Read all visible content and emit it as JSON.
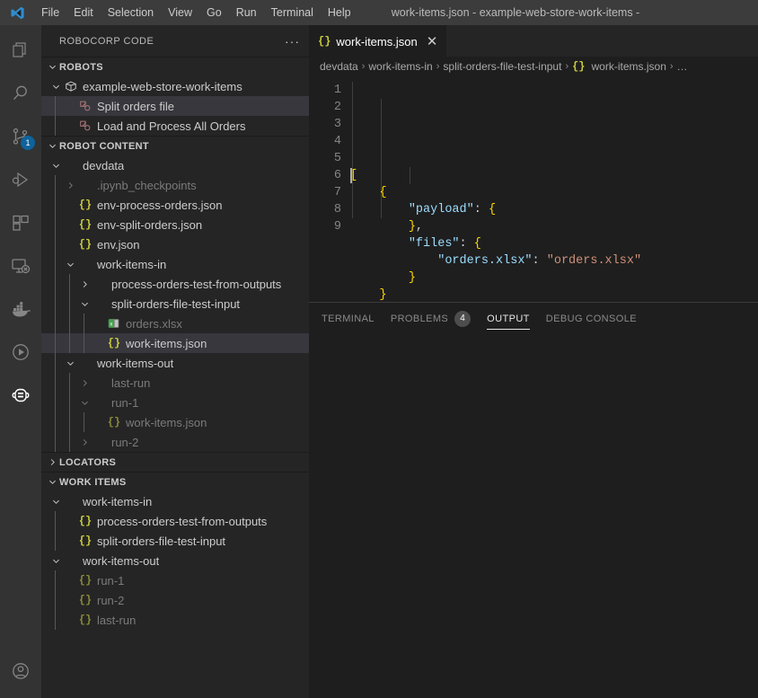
{
  "titlebar": {
    "window_title": "work-items.json - example-web-store-work-items -",
    "menu": [
      "File",
      "Edit",
      "Selection",
      "View",
      "Go",
      "Run",
      "Terminal",
      "Help"
    ]
  },
  "activitybar": {
    "items": [
      {
        "name": "explorer-icon",
        "active": false
      },
      {
        "name": "search-icon",
        "active": false
      },
      {
        "name": "source-control-icon",
        "active": false,
        "badge": "1"
      },
      {
        "name": "run-and-debug-icon",
        "active": false
      },
      {
        "name": "extensions-icon",
        "active": false
      },
      {
        "name": "remote-explorer-icon",
        "active": false
      },
      {
        "name": "docker-icon",
        "active": false
      },
      {
        "name": "test-play-icon",
        "active": false
      },
      {
        "name": "robocorp-robot-icon",
        "active": true
      }
    ],
    "bottom": [
      {
        "name": "account-icon",
        "active": false
      }
    ]
  },
  "sidebar": {
    "title": "ROBOCORP CODE",
    "more_actions": "···",
    "sections": [
      {
        "name": "robots",
        "label": "ROBOTS",
        "expanded": true,
        "rows": [
          {
            "label": "example-web-store-work-items",
            "indent": 1,
            "twisty": "down",
            "icon": "package-icon",
            "dim": false,
            "selected": false
          },
          {
            "label": "Split orders file",
            "indent": 2,
            "twisty": "none",
            "icon": "task-icon",
            "dim": false,
            "selected": true
          },
          {
            "label": "Load and Process All Orders",
            "indent": 2,
            "twisty": "none",
            "icon": "task-icon",
            "dim": false,
            "selected": false
          }
        ]
      },
      {
        "name": "robot-content",
        "label": "ROBOT CONTENT",
        "expanded": true,
        "rows": [
          {
            "label": "devdata",
            "indent": 1,
            "twisty": "down",
            "icon": "none",
            "dim": false,
            "selected": false
          },
          {
            "label": ".ipynb_checkpoints",
            "indent": 2,
            "twisty": "right",
            "icon": "none",
            "dim": true,
            "selected": false
          },
          {
            "label": "env-process-orders.json",
            "indent": 2,
            "twisty": "none",
            "icon": "json-icon",
            "dim": false,
            "selected": false
          },
          {
            "label": "env-split-orders.json",
            "indent": 2,
            "twisty": "none",
            "icon": "json-icon",
            "dim": false,
            "selected": false
          },
          {
            "label": "env.json",
            "indent": 2,
            "twisty": "none",
            "icon": "json-icon",
            "dim": false,
            "selected": false
          },
          {
            "label": "work-items-in",
            "indent": 2,
            "twisty": "down",
            "icon": "none",
            "dim": false,
            "selected": false
          },
          {
            "label": "process-orders-test-from-outputs",
            "indent": 3,
            "twisty": "right",
            "icon": "none",
            "dim": false,
            "selected": false
          },
          {
            "label": "split-orders-file-test-input",
            "indent": 3,
            "twisty": "down",
            "icon": "none",
            "dim": false,
            "selected": false
          },
          {
            "label": "orders.xlsx",
            "indent": 4,
            "twisty": "none",
            "icon": "xlsx-icon",
            "dim": true,
            "selected": false
          },
          {
            "label": "work-items.json",
            "indent": 4,
            "twisty": "none",
            "icon": "json-icon",
            "dim": false,
            "selected": true
          },
          {
            "label": "work-items-out",
            "indent": 2,
            "twisty": "down",
            "icon": "none",
            "dim": false,
            "selected": false
          },
          {
            "label": "last-run",
            "indent": 3,
            "twisty": "right",
            "icon": "none",
            "dim": true,
            "selected": false
          },
          {
            "label": "run-1",
            "indent": 3,
            "twisty": "down",
            "icon": "none",
            "dim": true,
            "selected": false
          },
          {
            "label": "work-items.json",
            "indent": 4,
            "twisty": "none",
            "icon": "json-icon",
            "dim": true,
            "selected": false
          },
          {
            "label": "run-2",
            "indent": 3,
            "twisty": "right",
            "icon": "none",
            "dim": true,
            "selected": false
          }
        ]
      },
      {
        "name": "locators",
        "label": "LOCATORS",
        "expanded": false,
        "rows": []
      },
      {
        "name": "work-items",
        "label": "WORK ITEMS",
        "expanded": true,
        "rows": [
          {
            "label": "work-items-in",
            "indent": 1,
            "twisty": "down",
            "icon": "none",
            "dim": false,
            "selected": false
          },
          {
            "label": "process-orders-test-from-outputs",
            "indent": 2,
            "twisty": "none",
            "icon": "json-icon",
            "dim": false,
            "selected": false
          },
          {
            "label": "split-orders-file-test-input",
            "indent": 2,
            "twisty": "none",
            "icon": "json-icon",
            "dim": false,
            "selected": false
          },
          {
            "label": "work-items-out",
            "indent": 1,
            "twisty": "down",
            "icon": "none",
            "dim": false,
            "selected": false
          },
          {
            "label": "run-1",
            "indent": 2,
            "twisty": "none",
            "icon": "json-icon",
            "dim": true,
            "selected": false
          },
          {
            "label": "run-2",
            "indent": 2,
            "twisty": "none",
            "icon": "json-icon",
            "dim": true,
            "selected": false
          },
          {
            "label": "last-run",
            "indent": 2,
            "twisty": "none",
            "icon": "json-icon",
            "dim": true,
            "selected": false
          }
        ]
      }
    ]
  },
  "editor": {
    "tab": {
      "label": "work-items.json",
      "icon": "json-icon",
      "close": "✕"
    },
    "breadcrumbs": [
      "devdata",
      "work-items-in",
      "split-orders-file-test-input",
      "work-items.json",
      "…"
    ],
    "breadcrumb_separator": "›",
    "line_numbers": [
      "1",
      "2",
      "3",
      "4",
      "5",
      "6",
      "7",
      "8",
      "9"
    ],
    "lines": [
      [
        {
          "t": "[",
          "c": "brk"
        }
      ],
      [
        {
          "t": "    ",
          "c": "punc"
        },
        {
          "t": "{",
          "c": "brk"
        }
      ],
      [
        {
          "t": "        ",
          "c": "punc"
        },
        {
          "t": "\"payload\"",
          "c": "key"
        },
        {
          "t": ": ",
          "c": "punc"
        },
        {
          "t": "{",
          "c": "brk"
        }
      ],
      [
        {
          "t": "        ",
          "c": "punc"
        },
        {
          "t": "}",
          "c": "brk"
        },
        {
          "t": ",",
          "c": "punc"
        }
      ],
      [
        {
          "t": "        ",
          "c": "punc"
        },
        {
          "t": "\"files\"",
          "c": "key"
        },
        {
          "t": ": ",
          "c": "punc"
        },
        {
          "t": "{",
          "c": "brk"
        }
      ],
      [
        {
          "t": "            ",
          "c": "punc"
        },
        {
          "t": "\"orders.xlsx\"",
          "c": "key"
        },
        {
          "t": ": ",
          "c": "punc"
        },
        {
          "t": "\"orders.xlsx\"",
          "c": "str"
        }
      ],
      [
        {
          "t": "        ",
          "c": "punc"
        },
        {
          "t": "}",
          "c": "brk"
        }
      ],
      [
        {
          "t": "    ",
          "c": "punc"
        },
        {
          "t": "}",
          "c": "brk"
        }
      ],
      [
        {
          "t": "]",
          "c": "brk"
        }
      ]
    ]
  },
  "panel": {
    "tabs": [
      {
        "label": "TERMINAL",
        "active": false,
        "count": null
      },
      {
        "label": "PROBLEMS",
        "active": false,
        "count": "4"
      },
      {
        "label": "OUTPUT",
        "active": true,
        "count": null
      },
      {
        "label": "DEBUG CONSOLE",
        "active": false,
        "count": null
      }
    ]
  },
  "colors": {
    "accent": "#0e639c",
    "editor_bg": "#1e1e1e",
    "sidebar_bg": "#252526",
    "titlebar_bg": "#3c3c3c",
    "selection_bg": "#37373d",
    "json_key": "#9cdcfe",
    "json_string": "#ce9178",
    "bracket": "#ffd700",
    "json_icon": "#cbcb41"
  }
}
